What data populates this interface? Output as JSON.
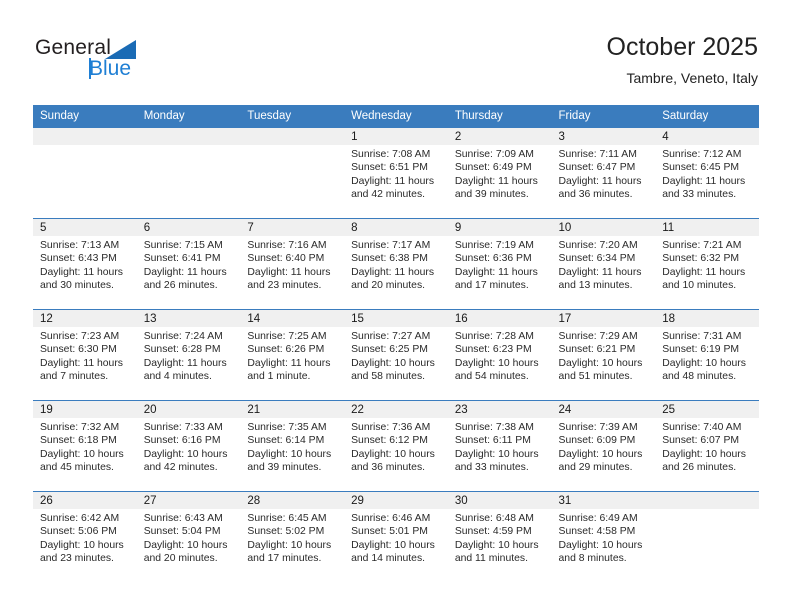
{
  "logo": {
    "word_one": "General",
    "word_two": "Blue",
    "accent_color": "#1f7fd4"
  },
  "header": {
    "title": "October 2025",
    "subtitle": "Tambre, Veneto, Italy"
  },
  "theme": {
    "header_blue": "#3a7cbe",
    "strip_gray": "#f0f0f0"
  },
  "calendar": {
    "weekday_headers": [
      "Sunday",
      "Monday",
      "Tuesday",
      "Wednesday",
      "Thursday",
      "Friday",
      "Saturday"
    ],
    "weeks": [
      [
        {
          "day": "",
          "empty": true
        },
        {
          "day": "",
          "empty": true
        },
        {
          "day": "",
          "empty": true
        },
        {
          "day": "1",
          "sunrise": "Sunrise: 7:08 AM",
          "sunset": "Sunset: 6:51 PM",
          "daylight_1": "Daylight: 11 hours",
          "daylight_2": "and 42 minutes."
        },
        {
          "day": "2",
          "sunrise": "Sunrise: 7:09 AM",
          "sunset": "Sunset: 6:49 PM",
          "daylight_1": "Daylight: 11 hours",
          "daylight_2": "and 39 minutes."
        },
        {
          "day": "3",
          "sunrise": "Sunrise: 7:11 AM",
          "sunset": "Sunset: 6:47 PM",
          "daylight_1": "Daylight: 11 hours",
          "daylight_2": "and 36 minutes."
        },
        {
          "day": "4",
          "sunrise": "Sunrise: 7:12 AM",
          "sunset": "Sunset: 6:45 PM",
          "daylight_1": "Daylight: 11 hours",
          "daylight_2": "and 33 minutes."
        }
      ],
      [
        {
          "day": "5",
          "sunrise": "Sunrise: 7:13 AM",
          "sunset": "Sunset: 6:43 PM",
          "daylight_1": "Daylight: 11 hours",
          "daylight_2": "and 30 minutes."
        },
        {
          "day": "6",
          "sunrise": "Sunrise: 7:15 AM",
          "sunset": "Sunset: 6:41 PM",
          "daylight_1": "Daylight: 11 hours",
          "daylight_2": "and 26 minutes."
        },
        {
          "day": "7",
          "sunrise": "Sunrise: 7:16 AM",
          "sunset": "Sunset: 6:40 PM",
          "daylight_1": "Daylight: 11 hours",
          "daylight_2": "and 23 minutes."
        },
        {
          "day": "8",
          "sunrise": "Sunrise: 7:17 AM",
          "sunset": "Sunset: 6:38 PM",
          "daylight_1": "Daylight: 11 hours",
          "daylight_2": "and 20 minutes."
        },
        {
          "day": "9",
          "sunrise": "Sunrise: 7:19 AM",
          "sunset": "Sunset: 6:36 PM",
          "daylight_1": "Daylight: 11 hours",
          "daylight_2": "and 17 minutes."
        },
        {
          "day": "10",
          "sunrise": "Sunrise: 7:20 AM",
          "sunset": "Sunset: 6:34 PM",
          "daylight_1": "Daylight: 11 hours",
          "daylight_2": "and 13 minutes."
        },
        {
          "day": "11",
          "sunrise": "Sunrise: 7:21 AM",
          "sunset": "Sunset: 6:32 PM",
          "daylight_1": "Daylight: 11 hours",
          "daylight_2": "and 10 minutes."
        }
      ],
      [
        {
          "day": "12",
          "sunrise": "Sunrise: 7:23 AM",
          "sunset": "Sunset: 6:30 PM",
          "daylight_1": "Daylight: 11 hours",
          "daylight_2": "and 7 minutes."
        },
        {
          "day": "13",
          "sunrise": "Sunrise: 7:24 AM",
          "sunset": "Sunset: 6:28 PM",
          "daylight_1": "Daylight: 11 hours",
          "daylight_2": "and 4 minutes."
        },
        {
          "day": "14",
          "sunrise": "Sunrise: 7:25 AM",
          "sunset": "Sunset: 6:26 PM",
          "daylight_1": "Daylight: 11 hours",
          "daylight_2": "and 1 minute."
        },
        {
          "day": "15",
          "sunrise": "Sunrise: 7:27 AM",
          "sunset": "Sunset: 6:25 PM",
          "daylight_1": "Daylight: 10 hours",
          "daylight_2": "and 58 minutes."
        },
        {
          "day": "16",
          "sunrise": "Sunrise: 7:28 AM",
          "sunset": "Sunset: 6:23 PM",
          "daylight_1": "Daylight: 10 hours",
          "daylight_2": "and 54 minutes."
        },
        {
          "day": "17",
          "sunrise": "Sunrise: 7:29 AM",
          "sunset": "Sunset: 6:21 PM",
          "daylight_1": "Daylight: 10 hours",
          "daylight_2": "and 51 minutes."
        },
        {
          "day": "18",
          "sunrise": "Sunrise: 7:31 AM",
          "sunset": "Sunset: 6:19 PM",
          "daylight_1": "Daylight: 10 hours",
          "daylight_2": "and 48 minutes."
        }
      ],
      [
        {
          "day": "19",
          "sunrise": "Sunrise: 7:32 AM",
          "sunset": "Sunset: 6:18 PM",
          "daylight_1": "Daylight: 10 hours",
          "daylight_2": "and 45 minutes."
        },
        {
          "day": "20",
          "sunrise": "Sunrise: 7:33 AM",
          "sunset": "Sunset: 6:16 PM",
          "daylight_1": "Daylight: 10 hours",
          "daylight_2": "and 42 minutes."
        },
        {
          "day": "21",
          "sunrise": "Sunrise: 7:35 AM",
          "sunset": "Sunset: 6:14 PM",
          "daylight_1": "Daylight: 10 hours",
          "daylight_2": "and 39 minutes."
        },
        {
          "day": "22",
          "sunrise": "Sunrise: 7:36 AM",
          "sunset": "Sunset: 6:12 PM",
          "daylight_1": "Daylight: 10 hours",
          "daylight_2": "and 36 minutes."
        },
        {
          "day": "23",
          "sunrise": "Sunrise: 7:38 AM",
          "sunset": "Sunset: 6:11 PM",
          "daylight_1": "Daylight: 10 hours",
          "daylight_2": "and 33 minutes."
        },
        {
          "day": "24",
          "sunrise": "Sunrise: 7:39 AM",
          "sunset": "Sunset: 6:09 PM",
          "daylight_1": "Daylight: 10 hours",
          "daylight_2": "and 29 minutes."
        },
        {
          "day": "25",
          "sunrise": "Sunrise: 7:40 AM",
          "sunset": "Sunset: 6:07 PM",
          "daylight_1": "Daylight: 10 hours",
          "daylight_2": "and 26 minutes."
        }
      ],
      [
        {
          "day": "26",
          "sunrise": "Sunrise: 6:42 AM",
          "sunset": "Sunset: 5:06 PM",
          "daylight_1": "Daylight: 10 hours",
          "daylight_2": "and 23 minutes."
        },
        {
          "day": "27",
          "sunrise": "Sunrise: 6:43 AM",
          "sunset": "Sunset: 5:04 PM",
          "daylight_1": "Daylight: 10 hours",
          "daylight_2": "and 20 minutes."
        },
        {
          "day": "28",
          "sunrise": "Sunrise: 6:45 AM",
          "sunset": "Sunset: 5:02 PM",
          "daylight_1": "Daylight: 10 hours",
          "daylight_2": "and 17 minutes."
        },
        {
          "day": "29",
          "sunrise": "Sunrise: 6:46 AM",
          "sunset": "Sunset: 5:01 PM",
          "daylight_1": "Daylight: 10 hours",
          "daylight_2": "and 14 minutes."
        },
        {
          "day": "30",
          "sunrise": "Sunrise: 6:48 AM",
          "sunset": "Sunset: 4:59 PM",
          "daylight_1": "Daylight: 10 hours",
          "daylight_2": "and 11 minutes."
        },
        {
          "day": "31",
          "sunrise": "Sunrise: 6:49 AM",
          "sunset": "Sunset: 4:58 PM",
          "daylight_1": "Daylight: 10 hours",
          "daylight_2": "and 8 minutes."
        },
        {
          "day": "",
          "empty": true
        }
      ]
    ]
  }
}
